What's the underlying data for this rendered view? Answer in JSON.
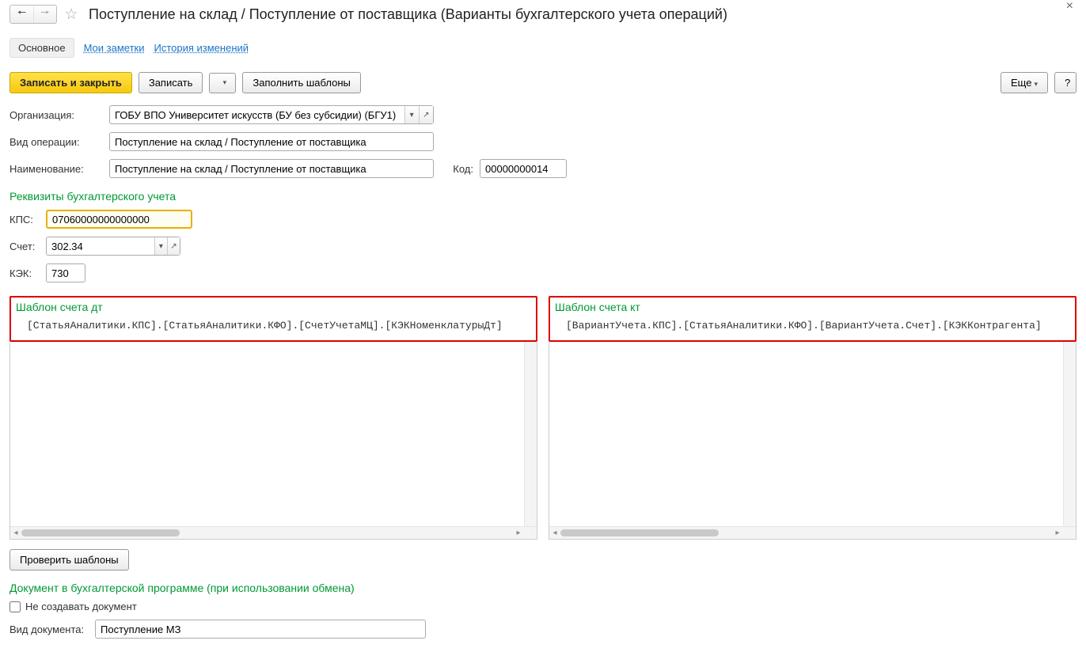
{
  "header": {
    "title": "Поступление на склад / Поступление от поставщика (Варианты бухгалтерского учета операций)"
  },
  "tabs": {
    "main": "Основное",
    "notes": "Мои заметки",
    "history": "История изменений"
  },
  "toolbar": {
    "save_close": "Записать и закрыть",
    "save": "Записать",
    "fill_templates": "Заполнить шаблоны",
    "more": "Еще",
    "help": "?"
  },
  "fields": {
    "org_label": "Организация:",
    "org_value": "ГОБУ ВПО Университет искусств (БУ без субсидии) (БГУ1)",
    "op_type_label": "Вид операции:",
    "op_type_value": "Поступление на склад / Поступление от поставщика",
    "name_label": "Наименование:",
    "name_value": "Поступление на склад / Поступление от поставщика",
    "code_label": "Код:",
    "code_value": "00000000014"
  },
  "accounting": {
    "section_title": "Реквизиты бухгалтерского учета",
    "kps_label": "КПС:",
    "kps_value": "07060000000000000",
    "account_label": "Счет:",
    "account_value": "302.34",
    "kek_label": "КЭК:",
    "kek_value": "730"
  },
  "templates": {
    "dt_title": "Шаблон счета дт",
    "dt_body": "[СтатьяАналитики.КПС].[СтатьяАналитики.КФО].[СчетУчетаМЦ].[КЭКНоменклатурыДт]",
    "kt_title": "Шаблон счета кт",
    "kt_body": "[ВариантУчета.КПС].[СтатьяАналитики.КФО].[ВариантУчета.Счет].[КЭККонтрагента]"
  },
  "check_templates": "Проверить шаблоны",
  "doc_section": {
    "title": "Документ в бухгалтерской программе (при использовании обмена)",
    "no_create_label": "Не создавать документ",
    "doc_type_label": "Вид документа:",
    "doc_type_value": "Поступление МЗ"
  }
}
